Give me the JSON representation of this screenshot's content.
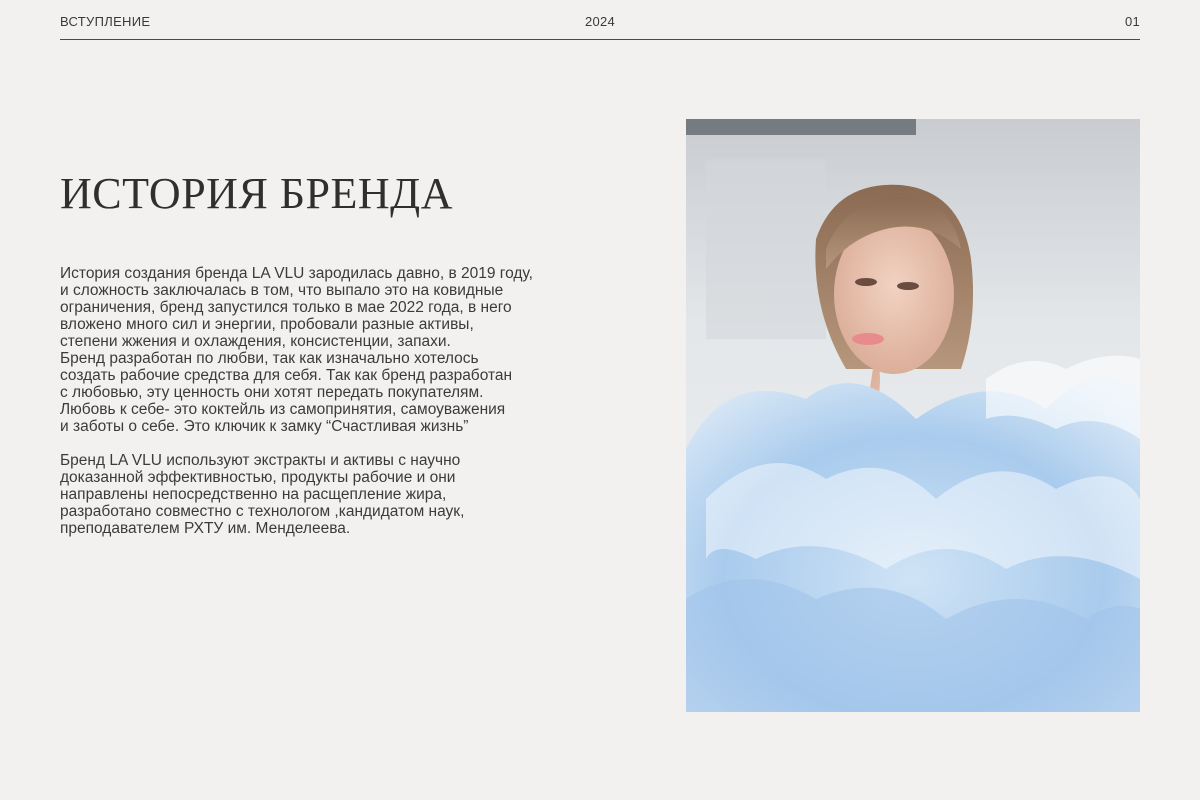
{
  "header": {
    "section": "ВСТУПЛЕНИЕ",
    "year": "2024",
    "page": "01"
  },
  "title": "ИСТОРИЯ БРЕНДА",
  "paragraphs": [
    {
      "lines": [
        "История создания бренда LA VLU зародилась давно, в 2019 году,",
        "и сложность заключалась в том, что выпало это на ковидные",
        "ограничения, бренд запустился только в мае 2022 года, в него",
        "вложено много сил и энергии, пробовали разные активы,",
        "степени жжения и охлаждения, консистенции, запахи.",
        "Бренд разработан по любви, так как изначально хотелось",
        "создать рабочие средства для себя. Так как бренд разработан",
        "с любовью, эту ценность они хотят передать покупателям.",
        "Любовь к себе- это коктейль из самопринятия, самоуважения",
        "и заботы о себе. Это ключик к замку “Счастливая жизнь”"
      ]
    },
    {
      "lines": [
        "Бренд LA VLU используют экстракты и активы с научно",
        "доказанной эффективностью, продукты рабочие и они",
        "направлены непосредственно на расщепление жира,",
        "разработано совместно с технологом ,кандидатом наук,",
        "преподавателем РХТУ им. Менделеева."
      ]
    }
  ]
}
